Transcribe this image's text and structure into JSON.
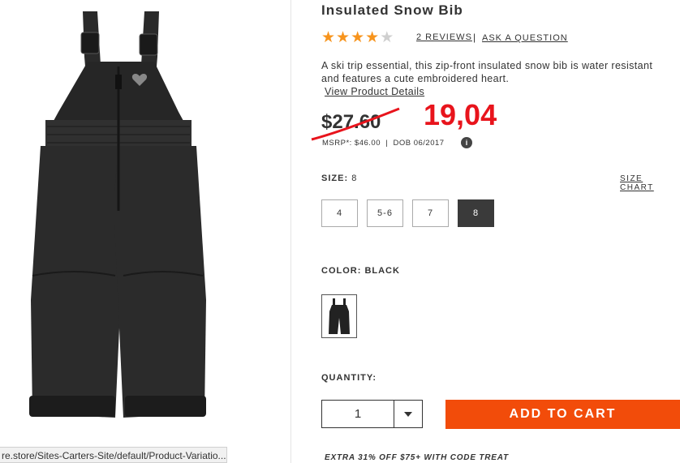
{
  "product": {
    "title": "Insulated Snow Bib",
    "rating": 4,
    "rating_max": 5,
    "reviews_label": "2 REVIEWS",
    "separator": "|",
    "ask_label": "ASK A QUESTION",
    "description": "A ski trip essential, this zip-front insulated snow bib is water resistant and features a cute embroidered heart.",
    "details_link": "View Product Details"
  },
  "pricing": {
    "old_price": "$27.60",
    "new_price": "19,04",
    "msrp_line": "MSRP*: $46.00  |  DOB 06/2017",
    "info_glyph": "i",
    "strike_color": "#e8141c"
  },
  "size": {
    "label": "SIZE:",
    "selected": "8",
    "chart_link": "SIZE CHART",
    "options": [
      "4",
      "5-6",
      "7",
      "8"
    ]
  },
  "color": {
    "label": "COLOR: BLACK"
  },
  "quantity": {
    "label": "QUANTITY:",
    "value": "1"
  },
  "cart": {
    "button_label": "ADD TO CART",
    "button_color": "#f24c0a"
  },
  "promo": "EXTRA 31% OFF $75+ WITH CODE TREAT",
  "status_url": "re.store/Sites-Carters-Site/default/Product-Variatio..."
}
